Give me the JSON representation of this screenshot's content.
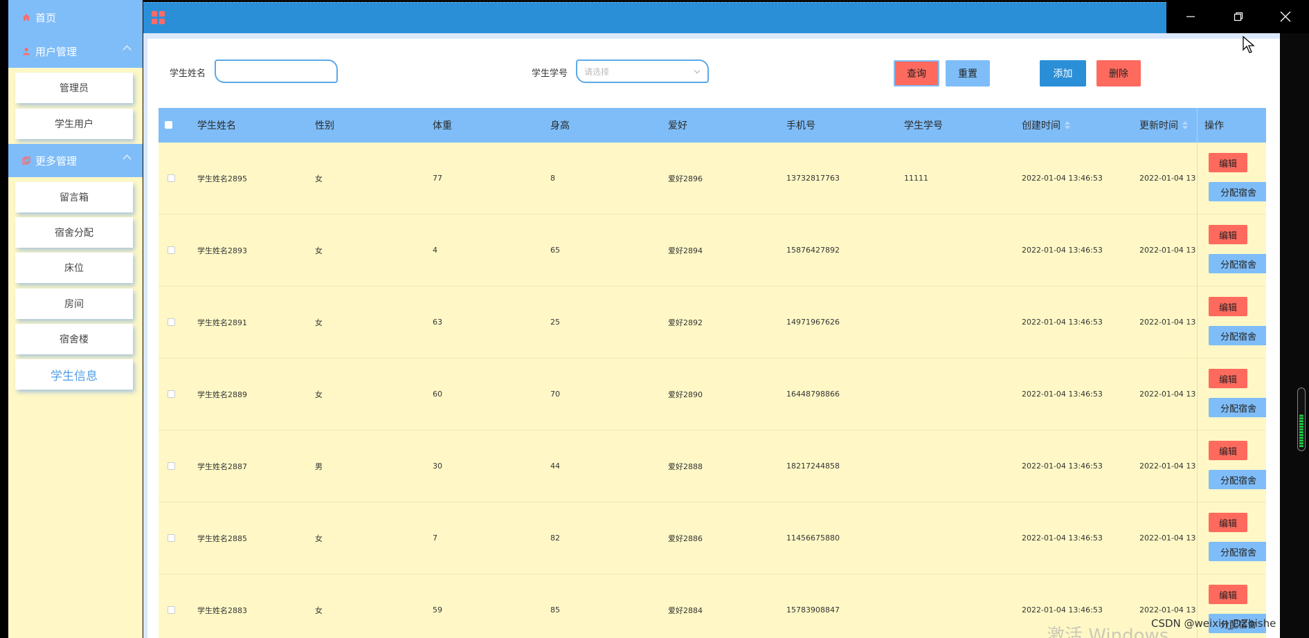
{
  "sidebar": {
    "home": "首页",
    "user_management": "用户管理",
    "user_items": [
      "管理员",
      "学生用户"
    ],
    "more_management": "更多管理",
    "more_items": [
      "留言箱",
      "宿舍分配",
      "床位",
      "房间",
      "宿舍楼",
      "学生信息"
    ]
  },
  "search": {
    "name_label": "学生姓名",
    "name_value": "",
    "number_label": "学生学号",
    "number_placeholder": "请选择"
  },
  "toolbar": {
    "query": "查询",
    "reset": "重置",
    "add": "添加",
    "delete": "删除"
  },
  "table": {
    "columns": [
      "学生姓名",
      "性别",
      "体重",
      "身高",
      "爱好",
      "手机号",
      "学生学号",
      "创建时间",
      "更新时间",
      "操作"
    ],
    "rows": [
      {
        "name": "学生姓名2895",
        "gender": "女",
        "weight": "77",
        "height": "8",
        "hobby": "爱好2896",
        "phone": "13732817763",
        "number": "11111",
        "created": "2022-01-04 13:46:53",
        "updated": "2022-01-04 13"
      },
      {
        "name": "学生姓名2893",
        "gender": "女",
        "weight": "4",
        "height": "65",
        "hobby": "爱好2894",
        "phone": "15876427892",
        "number": "",
        "created": "2022-01-04 13:46:53",
        "updated": "2022-01-04 13"
      },
      {
        "name": "学生姓名2891",
        "gender": "女",
        "weight": "63",
        "height": "25",
        "hobby": "爱好2892",
        "phone": "14971967626",
        "number": "",
        "created": "2022-01-04 13:46:53",
        "updated": "2022-01-04 13"
      },
      {
        "name": "学生姓名2889",
        "gender": "女",
        "weight": "60",
        "height": "70",
        "hobby": "爱好2890",
        "phone": "16448798866",
        "number": "",
        "created": "2022-01-04 13:46:53",
        "updated": "2022-01-04 13"
      },
      {
        "name": "学生姓名2887",
        "gender": "男",
        "weight": "30",
        "height": "44",
        "hobby": "爱好2888",
        "phone": "18217244858",
        "number": "",
        "created": "2022-01-04 13:46:53",
        "updated": "2022-01-04 13"
      },
      {
        "name": "学生姓名2885",
        "gender": "女",
        "weight": "7",
        "height": "82",
        "hobby": "爱好2886",
        "phone": "11456675880",
        "number": "",
        "created": "2022-01-04 13:46:53",
        "updated": "2022-01-04 13"
      },
      {
        "name": "学生姓名2883",
        "gender": "女",
        "weight": "59",
        "height": "85",
        "hobby": "爱好2884",
        "phone": "15783908847",
        "number": "",
        "created": "2022-01-04 13:46:53",
        "updated": "2022-01-04 13"
      }
    ],
    "edit_label": "编辑",
    "assign_label": "分配宿舍"
  },
  "overlay": {
    "activate_windows": "激活 Windows",
    "csdn": "CSDN @weixin_DZbishe"
  },
  "window_controls": [
    "minimize",
    "restore",
    "close"
  ],
  "colors": {
    "accent_blue": "#2b8fd8",
    "header_blue": "#7fbdf8",
    "row_yellow": "#fff8c6",
    "danger_red": "#ff6a5e"
  }
}
